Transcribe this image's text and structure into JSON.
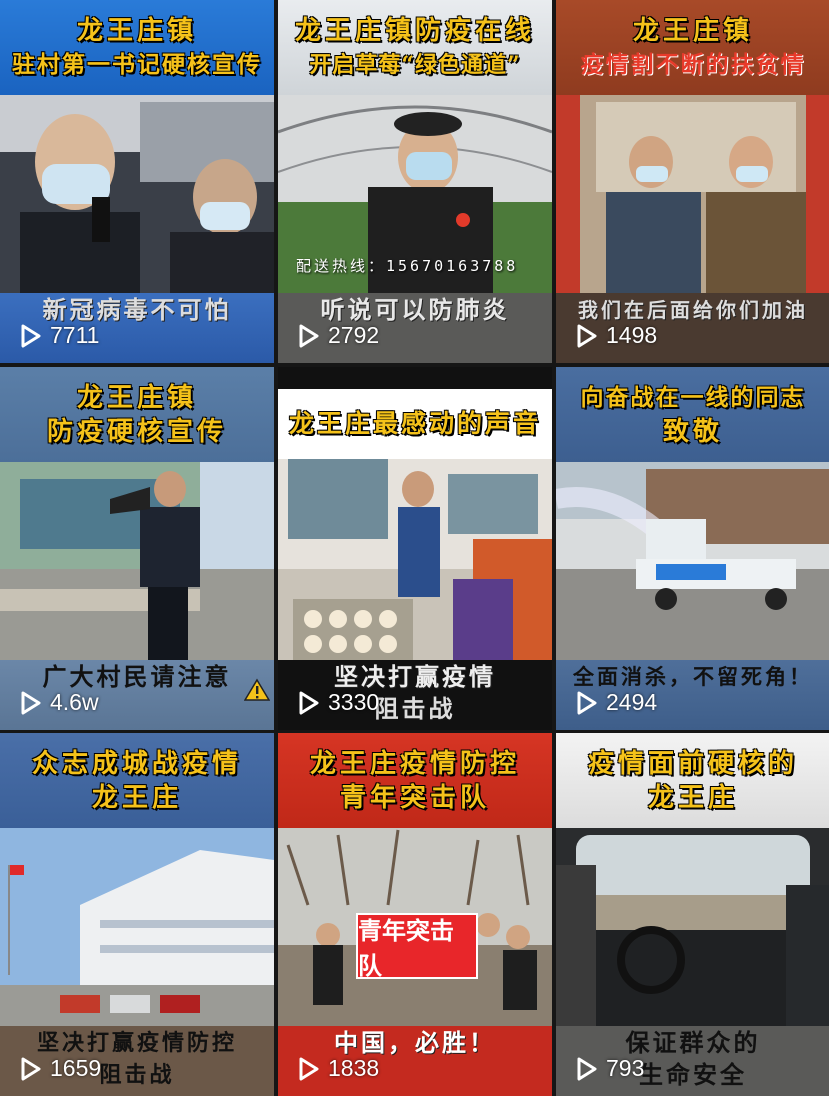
{
  "tiles": [
    {
      "title_lines": [
        "龙王庄镇",
        "驻村第一书记硬核宣传"
      ],
      "caption": "新冠病毒不可怕",
      "caption2": "",
      "views": "7711"
    },
    {
      "title_lines": [
        "龙王庄镇防疫在线",
        "开启草莓“绿色通道”"
      ],
      "caption": "听说可以防肺炎",
      "caption2": "",
      "views": "2792",
      "hotline": "配送热线：15670163788"
    },
    {
      "title_lines": [
        "龙王庄镇",
        "疫情割不断的扶贫情"
      ],
      "caption": "我们在后面给你们加油",
      "caption2": "",
      "views": "1498"
    },
    {
      "title_lines": [
        "龙王庄镇",
        "防疫硬核宣传"
      ],
      "caption": "广大村民请注意",
      "caption2": "",
      "views": "4.6w"
    },
    {
      "title_lines": [
        "龙王庄最感动的声音"
      ],
      "caption": "坚决打赢疫情",
      "caption2": "阻击战",
      "views": "3330"
    },
    {
      "title_lines": [
        "向奋战在一线的同志",
        "致敬"
      ],
      "caption": "全面消杀，不留死角！",
      "caption2": "",
      "views": "2494"
    },
    {
      "title_lines": [
        "众志成城战疫情",
        "龙王庄"
      ],
      "caption": "坚决打赢疫情防控",
      "caption2": "阻击战",
      "views": "1659"
    },
    {
      "title_lines": [
        "龙王庄疫情防控",
        "青年突击队"
      ],
      "caption": "中国，必胜！",
      "caption2": "",
      "views": "1838",
      "banner_text": "青年突击队"
    },
    {
      "title_lines": [
        "疫情面前硬核的",
        "龙王庄"
      ],
      "caption": "保证群众的",
      "caption2": "生命安全",
      "views": "793"
    }
  ]
}
